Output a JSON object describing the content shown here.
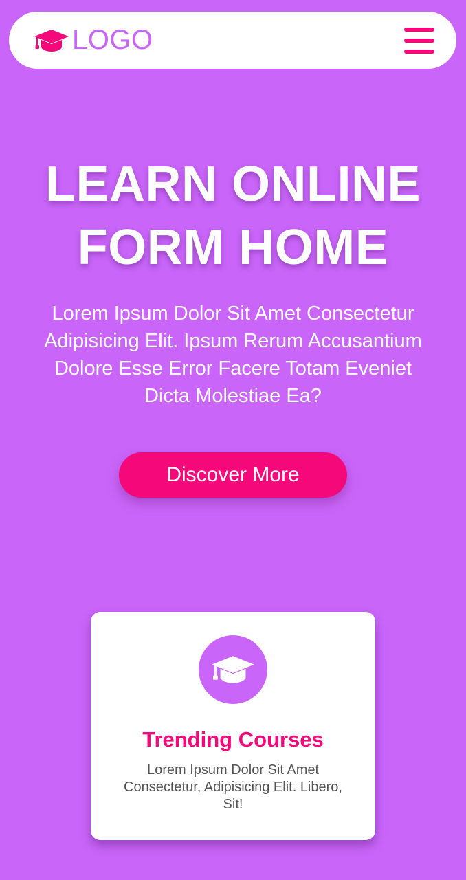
{
  "colors": {
    "background": "#c965f9",
    "accent": "#f5087a",
    "surface": "#ffffff",
    "muted_text": "#555555"
  },
  "header": {
    "logo_icon": "graduation-cap-icon",
    "logo_text": "LOGO",
    "menu_icon": "hamburger-menu-icon"
  },
  "hero": {
    "title_line1": "LEARN ONLINE",
    "title_line2": "FORM HOME",
    "text": "Lorem Ipsum Dolor Sit Amet Consectetur Adipisicing Elit. Ipsum Rerum Accusantium Dolore Esse Error Facere Totam Eveniet Dicta Molestiae Ea?",
    "button_label": "Discover More"
  },
  "card": {
    "icon": "graduation-cap-icon",
    "title": "Trending Courses",
    "text": "Lorem Ipsum Dolor Sit Amet Consectetur, Adipisicing Elit. Libero, Sit!"
  }
}
